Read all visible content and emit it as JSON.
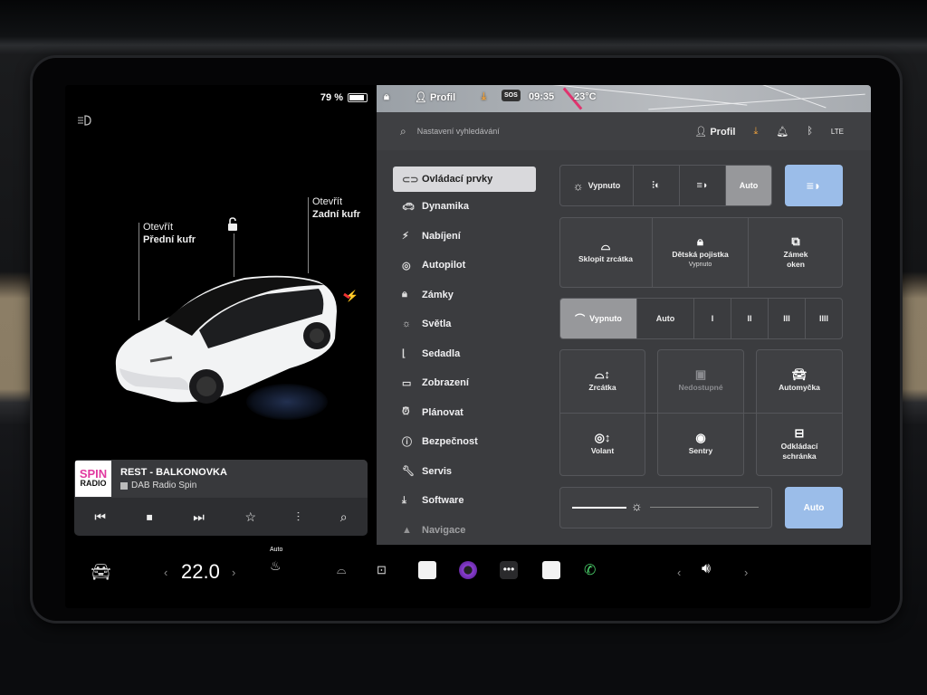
{
  "left": {
    "battery": "79 %",
    "frunk_line1": "Otevřít",
    "frunk_line2": "Přední kufr",
    "trunk_line1": "Otevřít",
    "trunk_line2": "Zadní kufr"
  },
  "media": {
    "logo_top": "SPIN",
    "logo_bottom": "RADIO",
    "title": "REST - BALKONOVKA",
    "station": "DAB Radio Spin"
  },
  "status": {
    "profile": "Profil",
    "sos": "SOS",
    "time": "09:35",
    "temp": "23°C"
  },
  "search": {
    "placeholder": "Nastavení vyhledávání",
    "profile": "Profil",
    "lte": "LTE"
  },
  "nav": [
    "Ovládací prvky",
    "Dynamika",
    "Nabíjení",
    "Autopilot",
    "Zámky",
    "Světla",
    "Sedadla",
    "Zobrazení",
    "Plánovat",
    "Bezpečnost",
    "Servis",
    "Software",
    "Navigace"
  ],
  "lights": {
    "off": "Vypnuto",
    "auto": "Auto"
  },
  "quick": {
    "fold_mirrors": "Sklopit zrcátka",
    "child_lock": "Dětská pojistka",
    "child_lock_state": "Vypnuto",
    "window_lock_1": "Zámek",
    "window_lock_2": "oken"
  },
  "wipers": {
    "off": "Vypnuto",
    "auto": "Auto",
    "s1": "I",
    "s2": "II",
    "s3": "III",
    "s4": "IIII"
  },
  "tiles": {
    "mirrors": "Zrcátka",
    "unavailable": "Nedostupné",
    "car_wash": "Automyčka",
    "wheel": "Volant",
    "sentry": "Sentry",
    "glovebox_1": "Odkládací",
    "glovebox_2": "schránka"
  },
  "brightness": {
    "auto": "Auto"
  },
  "dock": {
    "temperature": "22.0",
    "seat_auto": "Auto"
  },
  "colors": {
    "accent_blue": "#9bbde9",
    "active_nav": "#d9d9dc",
    "panel": "#3b3c3f"
  }
}
